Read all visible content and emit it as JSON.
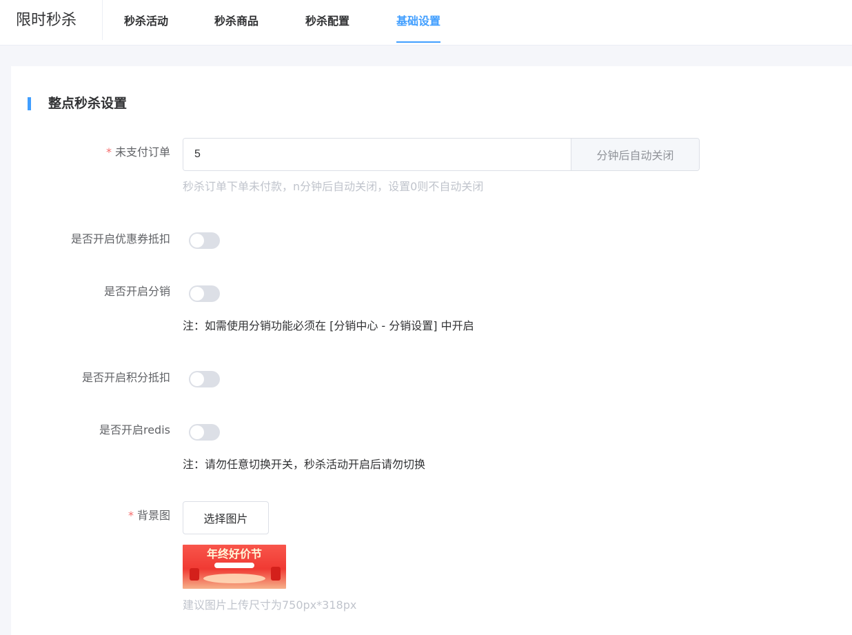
{
  "app": {
    "title": "限时秒杀"
  },
  "tabs": [
    {
      "label": "秒杀活动",
      "active": false
    },
    {
      "label": "秒杀商品",
      "active": false
    },
    {
      "label": "秒杀配置",
      "active": false
    },
    {
      "label": "基础设置",
      "active": true
    }
  ],
  "section": {
    "title": "整点秒杀设置"
  },
  "form": {
    "unpaid": {
      "required_mark": "*",
      "label": "未支付订单",
      "value": "5",
      "append": "分钟后自动关闭",
      "hint": "秒杀订单下单未付款，n分钟后自动关闭，设置0则不自动关闭"
    },
    "coupon": {
      "label": "是否开启优惠券抵扣",
      "on": false
    },
    "distribution": {
      "label": "是否开启分销",
      "on": false,
      "note": "注：如需使用分销功能必须在 [分销中心 - 分销设置] 中开启"
    },
    "points": {
      "label": "是否开启积分抵扣",
      "on": false
    },
    "redis": {
      "label": "是否开启redis",
      "on": false,
      "note": "注：请勿任意切换开关，秒杀活动开启后请勿切换"
    },
    "background": {
      "required_mark": "*",
      "label": "背景图",
      "button": "选择图片",
      "banner_text": "年终好价节",
      "hint": "建议图片上传尺寸为750px*318px"
    }
  },
  "colors": {
    "accent": "#409eff",
    "required": "#f56c6c",
    "switch_off": "#dcdfe6"
  }
}
